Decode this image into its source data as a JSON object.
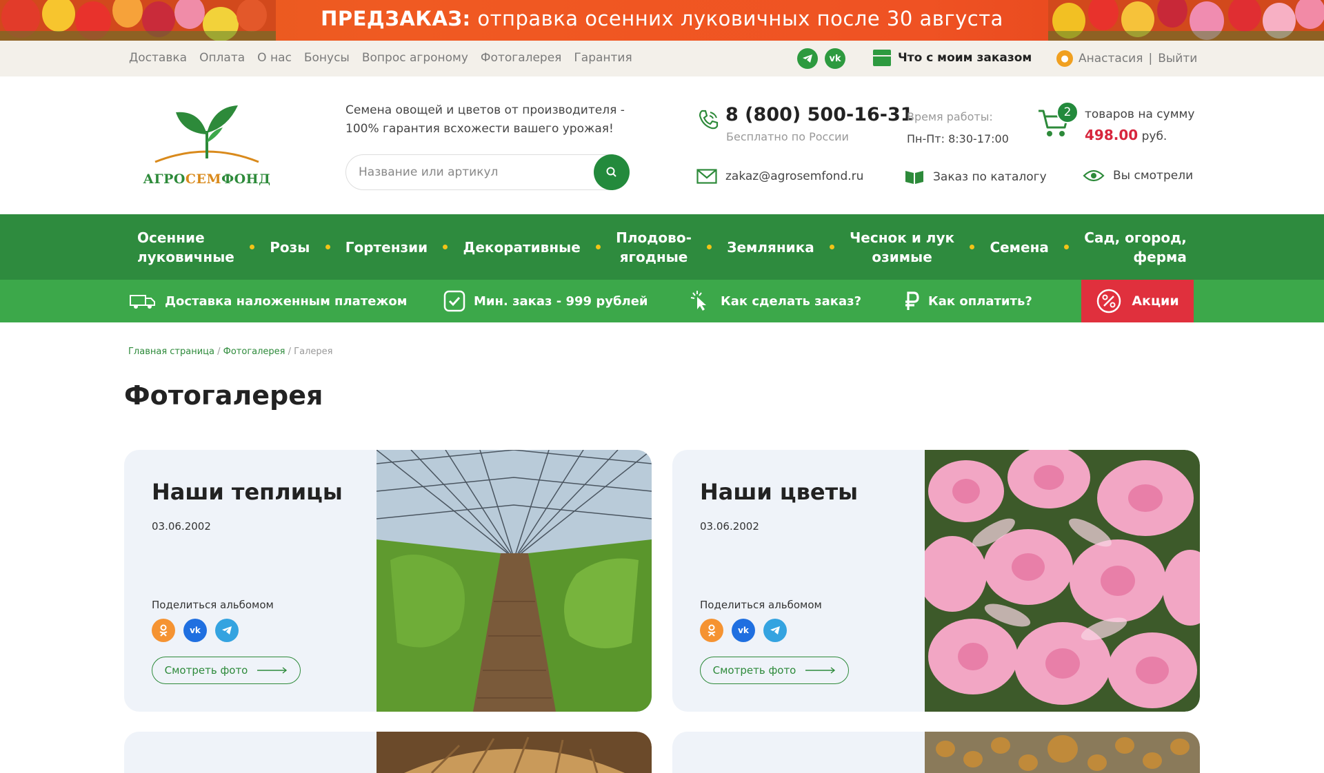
{
  "promo": {
    "bold": "ПРЕДЗАКАЗ:",
    "text": " отправка осенних луковичных после 30 августа"
  },
  "toplinks": [
    "Доставка",
    "Оплата",
    "О нас",
    "Бонусы",
    "Вопрос агроному",
    "Фотогалерея",
    "Гарантия"
  ],
  "order_status": "Что с моим заказом",
  "user": {
    "name": "Анастасия",
    "separator": "|",
    "logout": "Выйти"
  },
  "header": {
    "logo_text_left": "АГРО",
    "logo_text_mid": "СЕМ",
    "logo_text_right": "ФОНД",
    "tagline": "Семена овощей и цветов от производителя - 100% гарантия всхожести вашего урожая!",
    "search_placeholder": "Название или артикул",
    "phone": "8 (800) 500-16-31",
    "phone_sub": "Бесплатно по России",
    "hours_label": "Время работы:",
    "hours_value": "Пн-Пт: 8:30-17:00",
    "cart_count": "2",
    "cart_label": "товаров на сумму",
    "cart_sum": "498.00",
    "cart_currency": "руб.",
    "email": "zakaz@agrosemfond.ru",
    "catalog": "Заказ по каталогу",
    "viewed": "Вы смотрели"
  },
  "nav": [
    {
      "line1": "Осенние",
      "line2": "луковичные"
    },
    {
      "line1": "Розы",
      "line2": ""
    },
    {
      "line1": "Гортензии",
      "line2": ""
    },
    {
      "line1": "Декоративные",
      "line2": ""
    },
    {
      "line1": "Плодово-",
      "line2": "ягодные"
    },
    {
      "line1": "Земляника",
      "line2": ""
    },
    {
      "line1": "Чеснок и лук",
      "line2": "озимые"
    },
    {
      "line1": "Семена",
      "line2": ""
    },
    {
      "line1": "Сад, огород,",
      "line2": "ферма"
    }
  ],
  "subbar": {
    "delivery": "Доставка наложенным платежом",
    "min_order": "Мин. заказ - 999 рублей",
    "how_order": "Как сделать заказ?",
    "how_pay": "Как оплатить?",
    "sales": "Акции"
  },
  "breadcrumb": {
    "home": "Главная страница",
    "gallery": "Фотогалерея",
    "current": "Галерея",
    "sep": " / "
  },
  "page_title": "Фотогалерея",
  "cards": [
    {
      "title": "Наши теплицы",
      "date": "03.06.2002",
      "share": "Поделиться альбомом",
      "button": "Смотреть фото"
    },
    {
      "title": "Наши цветы",
      "date": "03.06.2002",
      "share": "Поделиться альбомом",
      "button": "Смотреть фото"
    }
  ],
  "colors": {
    "green_dark": "#2e8b3e",
    "green_light": "#3ca84a",
    "red": "#e0303d",
    "promo": "#ef5223",
    "accent_yellow": "#f2c418"
  }
}
